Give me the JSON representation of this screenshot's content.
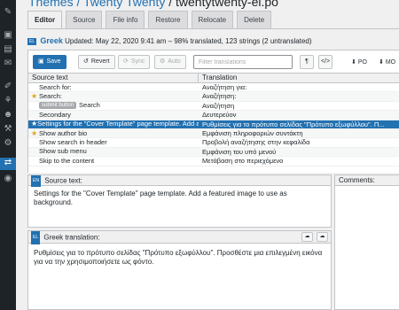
{
  "page": {
    "title_link": "Themes / Twenty Twenty",
    "title_rest": " / twentytwenty-el.po"
  },
  "tabs": [
    "Editor",
    "Source",
    "File info",
    "Restore",
    "Relocate",
    "Delete"
  ],
  "meta": {
    "flag": "EL",
    "language": "Greek",
    "status": "Updated: May 22, 2020 9:41 am – 98% translated, 123 strings (2 untranslated)"
  },
  "toolbar": {
    "save": "Save",
    "revert": "Revert",
    "sync": "Sync",
    "auto": "Auto",
    "filter_placeholder": "Filter translations",
    "pilcrow": "¶",
    "code": "</>",
    "download_po": "PO",
    "download_mo": "MO"
  },
  "grid": {
    "headers": [
      "Source text",
      "Translation"
    ],
    "rows": [
      {
        "source": "Search for:",
        "translation": "Αναζήτηση για:",
        "star": false,
        "pill": ""
      },
      {
        "source": "Search:",
        "translation": "Αναζήτηση:",
        "star": true,
        "pill": ""
      },
      {
        "source": "Search",
        "translation": "Αναζήτηση",
        "star": false,
        "pill": "submit button"
      },
      {
        "source": "Secondary",
        "translation": "Δευτερεύον",
        "star": false,
        "pill": ""
      },
      {
        "source": "Settings for the \"Cover Template\" page template. Add a fe...",
        "translation": "Ρυθμίσεις για το πρότυπο σελίδας \"Πρότυπο εξωφύλλου\". Π...",
        "star": true,
        "pill": "",
        "selected": true
      },
      {
        "source": "Show author bio",
        "translation": "Εμφάνιση πληροφοριών συντάκτη",
        "star": true,
        "pill": ""
      },
      {
        "source": "Show search in header",
        "translation": "Προβολή αναζήτησης στην κεφαλίδα",
        "star": false,
        "pill": ""
      },
      {
        "source": "Show sub menu",
        "translation": "Εμφάνιση του υπό μενού",
        "star": false,
        "pill": ""
      },
      {
        "source": "Skip to the content",
        "translation": "Μετάβαση στο περιεχόμενο",
        "star": false,
        "pill": ""
      }
    ]
  },
  "source_panel": {
    "flag": "EN",
    "label": "Source text:",
    "text": "Settings for the \"Cover Template\" page template. Add a featured image to use as background."
  },
  "comments": {
    "label": "Comments:"
  },
  "translation_panel": {
    "flag": "EL",
    "label": "Greek translation:",
    "text": "Ρυθμίσεις για το πρότυπο σελίδας \"Πρότυπο εξωφύλλου\". Προσθέστε μια επιλεγμένη εικόνα για να την χρησιμοποιήσετε ως φόντο."
  },
  "colors": {
    "accent": "#2271b1",
    "star": "#dba617",
    "sidebar": "#1d2327"
  }
}
